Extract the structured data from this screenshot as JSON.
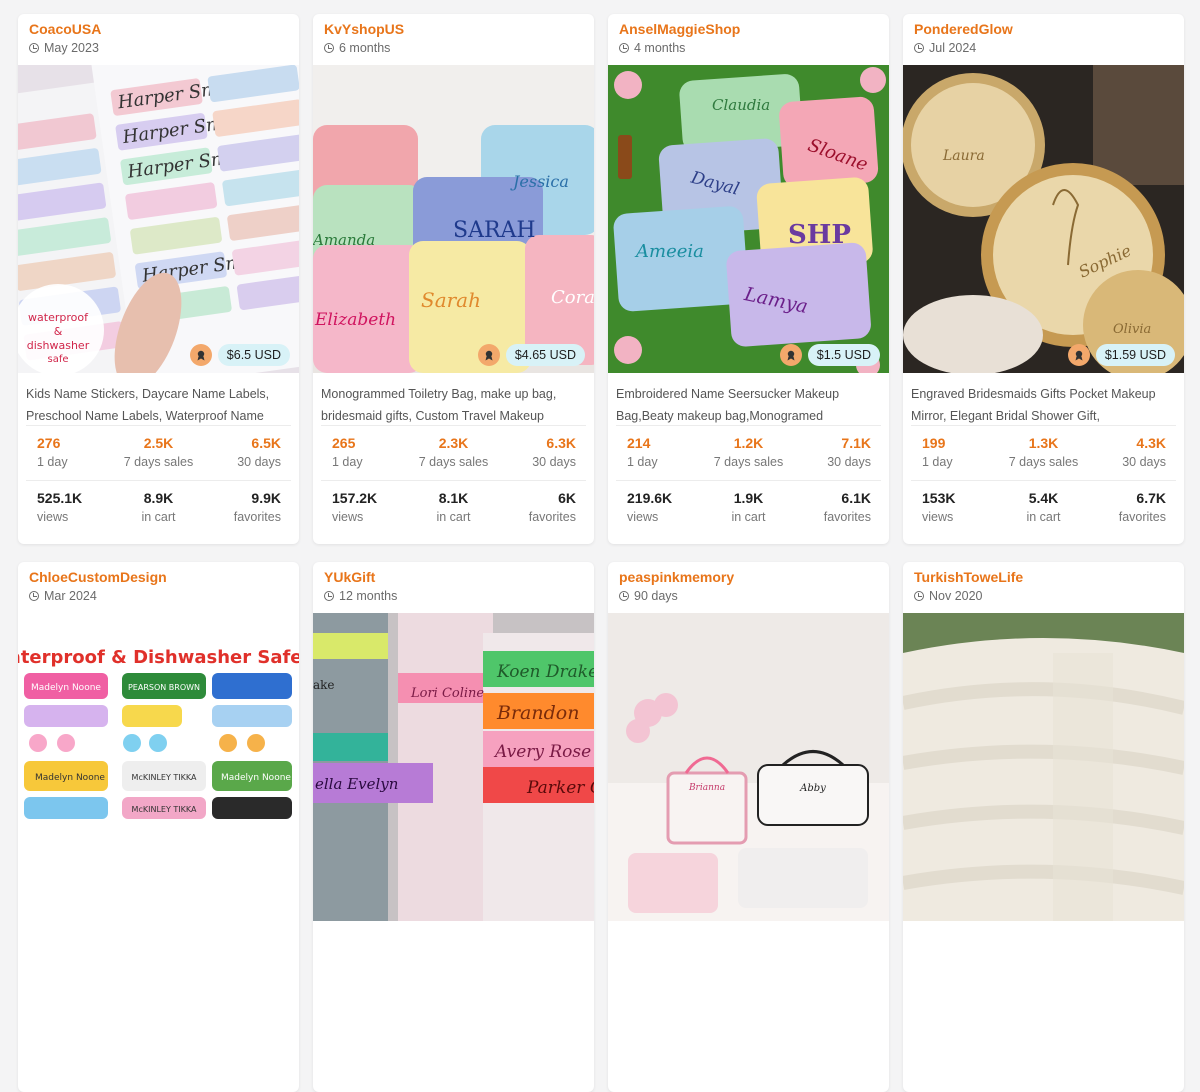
{
  "cards": [
    {
      "shop": "CoacoUSA",
      "age": "May 2023",
      "price": "$6.5 USD",
      "title1": "Kids Name Stickers, Daycare Name Labels,",
      "title2": "Preschool Name Labels, Waterproof Name",
      "day": "276",
      "day_lbl": "1 day",
      "week": "2.5K",
      "week_lbl": "7 days sales",
      "month": "6.5K",
      "month_lbl": "30 days",
      "views": "525.1K",
      "views_lbl": "views",
      "cart": "8.9K",
      "cart_lbl": "in cart",
      "fav": "9.9K",
      "fav_lbl": "favorites",
      "img_labels": [
        "Harper Smith",
        "Harper Smith",
        "Harper Smith",
        "Harper Smith"
      ],
      "img_badge": "waterproof & dishwasher safe"
    },
    {
      "shop": "KvYshopUS",
      "age": "6 months",
      "price": "$4.65 USD",
      "title1": "Monogrammed Toiletry Bag, make up bag,",
      "title2": "bridesmaid gifts, Custom Travel Makeup",
      "day": "265",
      "day_lbl": "1 day",
      "week": "2.3K",
      "week_lbl": "7 days sales",
      "month": "6.3K",
      "month_lbl": "30 days",
      "views": "157.2K",
      "views_lbl": "views",
      "cart": "8.1K",
      "cart_lbl": "in cart",
      "fav": "6K",
      "fav_lbl": "favorites",
      "img_labels": [
        "SARAH",
        "Sarah",
        "Elizabeth",
        "Jessica",
        "Amanda",
        "Cora"
      ]
    },
    {
      "shop": "AnselMaggieShop",
      "age": "4 months",
      "price": "$1.5 USD",
      "title1": "Embroidered Name Seersucker Makeup",
      "title2": "Bag,Beaty makeup bag,Monogramed",
      "day": "214",
      "day_lbl": "1 day",
      "week": "1.2K",
      "week_lbl": "7 days sales",
      "month": "7.1K",
      "month_lbl": "30 days",
      "views": "219.6K",
      "views_lbl": "views",
      "cart": "1.9K",
      "cart_lbl": "in cart",
      "fav": "6.1K",
      "fav_lbl": "favorites",
      "img_labels": [
        "Claudia",
        "Sloane",
        "Dayal",
        "SHP",
        "Ameeia",
        "Lamya"
      ]
    },
    {
      "shop": "PonderedGlow",
      "age": "Jul 2024",
      "price": "$1.59 USD",
      "title1": "Engraved Bridesmaids Gifts Pocket Makeup",
      "title2": "Mirror, Elegant Bridal Shower Gift,",
      "day": "199",
      "day_lbl": "1 day",
      "week": "1.3K",
      "week_lbl": "7 days sales",
      "month": "4.3K",
      "month_lbl": "30 days",
      "views": "153K",
      "views_lbl": "views",
      "cart": "5.4K",
      "cart_lbl": "in cart",
      "fav": "6.7K",
      "fav_lbl": "favorites",
      "img_labels": [
        "Laura",
        "Sophie",
        "Olivia"
      ]
    },
    {
      "shop": "ChloeCustomDesign",
      "age": "Mar 2024",
      "img_labels": [
        "Waterproof & Dishwasher Safe",
        "Madelyn Noone",
        "PEARSON BROWN",
        "McKINLEY TIKKA",
        "Madelyn Noone",
        "McKINLEY TIKKA",
        "Madelyn Noone"
      ]
    },
    {
      "shop": "YUkGift",
      "age": "12 months",
      "img_labels": [
        "Koen Drake",
        "Brandon",
        "Avery Rose",
        "Parker G",
        "Lori Coline",
        "ella Evelyn",
        "ake"
      ]
    },
    {
      "shop": "peaspinkmemory",
      "age": "90 days",
      "img_labels": [
        "Brianna",
        "Abby"
      ]
    },
    {
      "shop": "TurkishToweLife",
      "age": "Nov 2020",
      "img_labels": []
    }
  ]
}
